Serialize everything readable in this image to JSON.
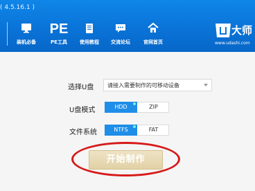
{
  "header": {
    "version": "( 4.5.16.1 )",
    "nav": [
      {
        "label": "装机必备",
        "icon": "monitor-icon"
      },
      {
        "label": "PE工具",
        "icon_text": "PE"
      },
      {
        "label": "使用教程",
        "icon": "book-icon"
      },
      {
        "label": "交流论坛",
        "icon": "chat-icon"
      },
      {
        "label": "官网首页",
        "icon": "home-icon"
      }
    ],
    "brand": {
      "name": "大师",
      "url": "www.udashi.com"
    }
  },
  "form": {
    "select_u_label": "选择U盘",
    "select_u_placeholder": "请接入需要制作的可移动设备",
    "udisk_mode_label": "U盘模式",
    "udisk_mode_options": [
      "HDD",
      "ZIP"
    ],
    "udisk_mode_selected": "HDD",
    "filesystem_label": "文件系统",
    "filesystem_options": [
      "NTFS",
      "FAT"
    ],
    "filesystem_selected": "NTFS",
    "start_button": "开始制作"
  },
  "colors": {
    "header_blue": "#0a73d8",
    "active_blue": "#1f8ee8",
    "start_button": "#e6d7ad",
    "highlight_red": "#d71919"
  }
}
